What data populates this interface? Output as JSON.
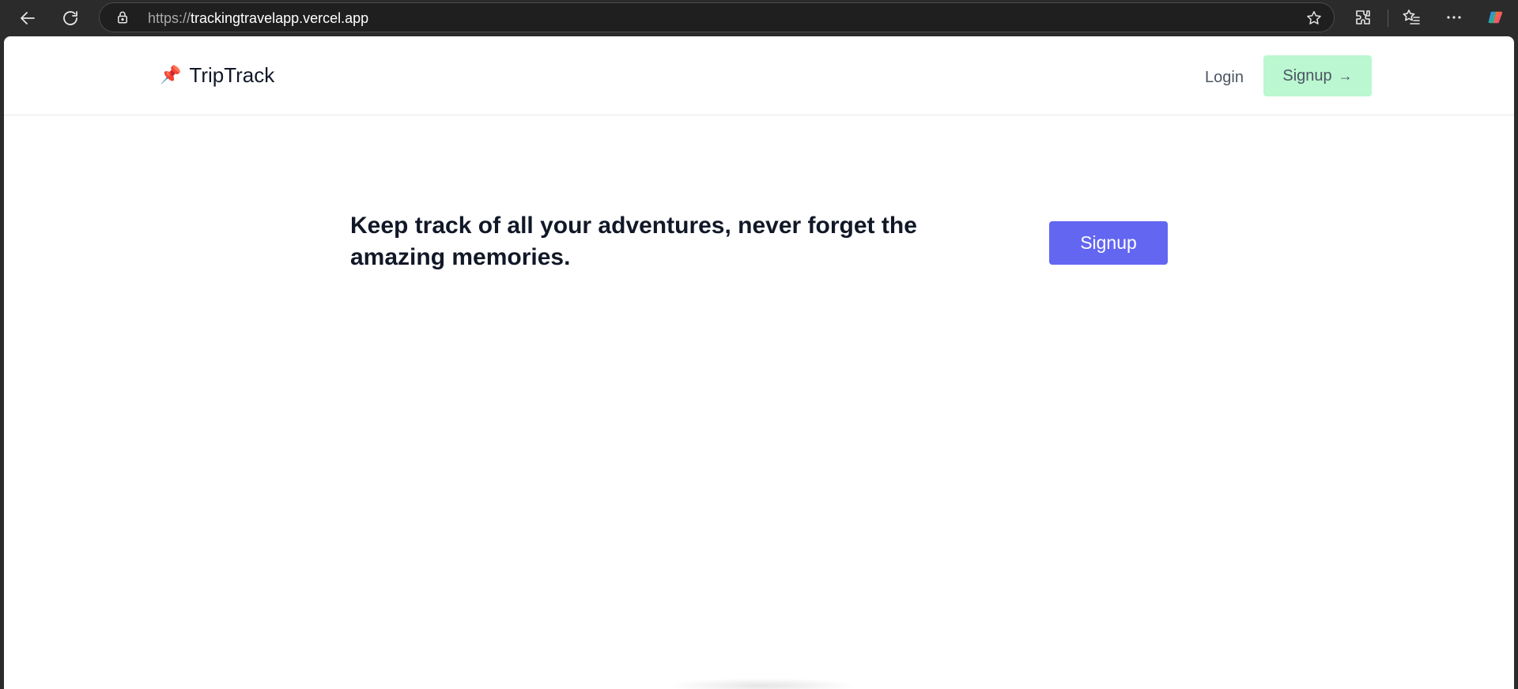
{
  "browser": {
    "url_scheme": "https://",
    "url_host": "trackingtravelapp.vercel.app",
    "icons": [
      "back-arrow-icon",
      "reload-icon",
      "lock-icon",
      "star-icon",
      "extensions-icon",
      "favorites-icon",
      "more-icon",
      "copilot-icon"
    ]
  },
  "header": {
    "brand_emoji": "📌",
    "brand_name": "TripTrack",
    "login_label": "Login",
    "signup_label": "Signup",
    "signup_arrow": "→"
  },
  "hero": {
    "tagline": "Keep track of all your adventures, never forget the amazing memories.",
    "signup_label": "Signup"
  },
  "colors": {
    "primary": "#6366f1",
    "signup_top_bg": "#bbf7d0",
    "text_dark": "#111827",
    "text_muted": "#4b5563"
  }
}
